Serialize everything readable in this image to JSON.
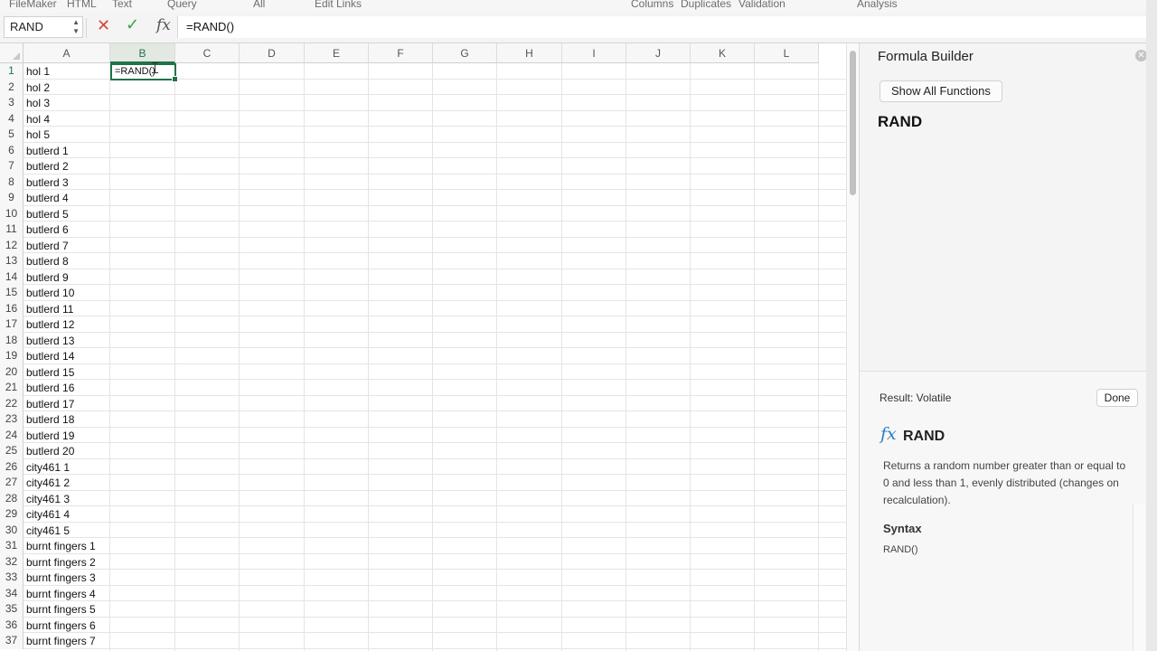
{
  "ribbon": {
    "items": [
      "FileMaker",
      "HTML",
      "Text",
      "Query",
      "All",
      "Edit Links",
      "Columns",
      "Duplicates",
      "Validation",
      "Analysis"
    ]
  },
  "formula_bar": {
    "name_box": "RAND",
    "formula": "=RAND()"
  },
  "sheet": {
    "columns": [
      "A",
      "B",
      "C",
      "D",
      "E",
      "F",
      "G",
      "H",
      "I",
      "J",
      "K",
      "L"
    ],
    "selected_column": "B",
    "rows": [
      "1",
      "2",
      "3",
      "4",
      "5",
      "6",
      "7",
      "8",
      "9",
      "10",
      "11",
      "12",
      "13",
      "14",
      "15",
      "16",
      "17",
      "18",
      "19",
      "20",
      "21",
      "22",
      "23",
      "24",
      "25",
      "26",
      "27",
      "28",
      "29",
      "30",
      "31",
      "32",
      "33",
      "34",
      "35",
      "36",
      "37"
    ],
    "column_a": [
      "hol 1",
      "hol 2",
      "hol 3",
      "hol 4",
      "hol 5",
      "butlerd 1",
      "butlerd 2",
      "butlerd 3",
      "butlerd 4",
      "butlerd 5",
      "butlerd 6",
      "butlerd 7",
      "butlerd 8",
      "butlerd 9",
      "butlerd 10",
      "butlerd 11",
      "butlerd 12",
      "butlerd 13",
      "butlerd 14",
      "butlerd 15",
      "butlerd 16",
      "butlerd 17",
      "butlerd 18",
      "butlerd 19",
      "butlerd 20",
      "city461 1",
      "city461 2",
      "city461 3",
      "city461 4",
      "city461 5",
      "burnt fingers 1",
      "burnt fingers 2",
      "burnt fingers 3",
      "burnt fingers 4",
      "burnt fingers 5",
      "burnt fingers 6",
      "burnt fingers 7"
    ],
    "active_cell_text": "=RAND()"
  },
  "panel": {
    "title": "Formula Builder",
    "show_all_label": "Show All Functions",
    "function_name": "RAND",
    "result_label": "Result: Volatile",
    "done_label": "Done",
    "detail_name": "RAND",
    "description": "Returns a random number greater than or equal to 0 and less than 1, evenly distributed (changes on recalculation).",
    "syntax_heading": "Syntax",
    "syntax": "RAND()"
  },
  "colors": {
    "accent": "#217346",
    "cancel": "#d9453a",
    "enter": "#3ca14a",
    "fx": "#2d7fc1"
  }
}
